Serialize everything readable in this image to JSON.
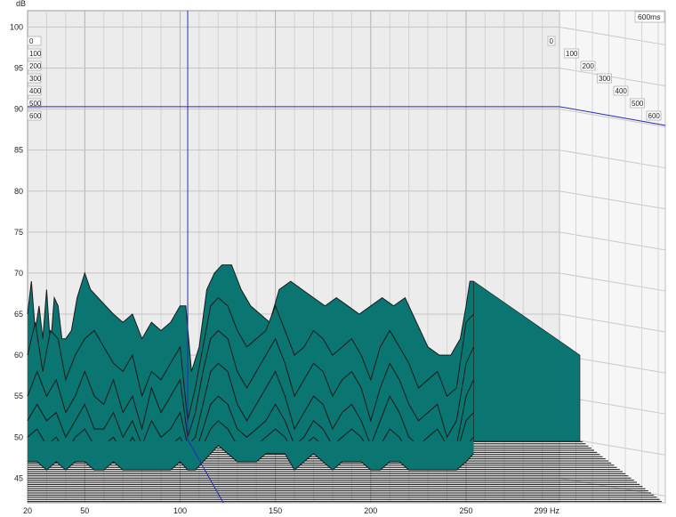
{
  "chart_data": {
    "type": "area",
    "title": "",
    "xlabel": "Hz",
    "ylabel": "dB",
    "x_ticks": [
      20,
      50,
      100,
      150,
      200,
      250,
      299
    ],
    "x_tick_labels": [
      "20",
      "50",
      "100",
      "150",
      "200",
      "250",
      "299 Hz"
    ],
    "y_ticks": [
      45,
      50,
      55,
      60,
      65,
      70,
      75,
      80,
      85,
      90,
      95,
      100
    ],
    "xlim": [
      20,
      299
    ],
    "ylim": [
      42,
      102
    ],
    "time_unit": "ms",
    "time_slices": [
      0,
      100,
      200,
      300,
      400,
      500,
      600
    ],
    "time_label_max": "600ms",
    "cursor": {
      "freq_hz": 104,
      "level_db": 90.3
    },
    "grid": true,
    "fill_color": "#0b7571",
    "curve_color": "#1a1a1a",
    "cursor_color": "#2a2ab4",
    "series": [
      {
        "name": "0",
        "x": [
          20,
          22,
          24,
          26,
          28,
          30,
          32,
          34,
          36,
          38,
          40,
          43,
          46,
          50,
          53,
          57,
          61,
          65,
          70,
          75,
          80,
          85,
          90,
          95,
          100,
          103,
          106,
          110,
          114,
          118,
          122,
          127,
          132,
          137,
          142,
          147,
          152,
          158,
          164,
          170,
          176,
          182,
          188,
          194,
          200,
          206,
          212,
          218,
          224,
          230,
          236,
          242,
          247,
          250,
          252,
          254
        ],
        "y": [
          65,
          69,
          63,
          66,
          62,
          68,
          61,
          67,
          66,
          62,
          62,
          63,
          67,
          70,
          68,
          67,
          66,
          65,
          64,
          65,
          62,
          64,
          63,
          64,
          66,
          66,
          58,
          61,
          68,
          70,
          71,
          71,
          68,
          66,
          65,
          64,
          68,
          69,
          68,
          67,
          66,
          67,
          66,
          65,
          66,
          67,
          66,
          67,
          64,
          61,
          60,
          60,
          62,
          66,
          69,
          69
        ]
      },
      {
        "name": "100",
        "x": [
          20,
          24,
          28,
          32,
          36,
          40,
          45,
          50,
          55,
          60,
          65,
          70,
          75,
          80,
          85,
          90,
          95,
          100,
          104,
          108,
          112,
          116,
          120,
          125,
          130,
          135,
          140,
          145,
          150,
          155,
          160,
          165,
          170,
          175,
          180,
          185,
          190,
          195,
          200,
          205,
          210,
          215,
          220,
          225,
          230,
          235,
          240,
          245,
          250,
          254
        ],
        "y": [
          60,
          64,
          58,
          63,
          62,
          57,
          60,
          62,
          63,
          61,
          59,
          58,
          60,
          55,
          58,
          57,
          59,
          61,
          52,
          56,
          61,
          66,
          67,
          66,
          63,
          61,
          62,
          63,
          66,
          63,
          60,
          61,
          63,
          62,
          60,
          61,
          62,
          60,
          57,
          61,
          63,
          61,
          59,
          56,
          57,
          58,
          55,
          56,
          64,
          65
        ]
      },
      {
        "name": "200",
        "x": [
          20,
          25,
          30,
          35,
          40,
          45,
          50,
          55,
          60,
          65,
          70,
          75,
          80,
          85,
          90,
          95,
          100,
          104,
          108,
          112,
          116,
          120,
          125,
          130,
          135,
          140,
          145,
          150,
          155,
          160,
          165,
          170,
          175,
          180,
          185,
          190,
          195,
          200,
          205,
          210,
          215,
          220,
          225,
          230,
          235,
          240,
          245,
          250,
          254
        ],
        "y": [
          55,
          58,
          55,
          57,
          53,
          55,
          58,
          55,
          54,
          57,
          53,
          55,
          51,
          56,
          53,
          55,
          57,
          50,
          53,
          58,
          62,
          63,
          62,
          58,
          56,
          58,
          60,
          62,
          59,
          55,
          57,
          59,
          58,
          55,
          57,
          58,
          56,
          52,
          56,
          59,
          57,
          54,
          52,
          53,
          54,
          50,
          52,
          59,
          61
        ]
      },
      {
        "name": "300",
        "x": [
          20,
          25,
          30,
          35,
          40,
          45,
          50,
          55,
          60,
          65,
          70,
          75,
          80,
          85,
          90,
          95,
          100,
          104,
          108,
          112,
          116,
          120,
          125,
          130,
          135,
          140,
          145,
          150,
          155,
          160,
          165,
          170,
          175,
          180,
          185,
          190,
          195,
          200,
          205,
          210,
          215,
          220,
          225,
          230,
          235,
          240,
          245,
          250,
          254
        ],
        "y": [
          52,
          54,
          52,
          53,
          50,
          52,
          54,
          51,
          51,
          53,
          50,
          52,
          49,
          52,
          50,
          51,
          53,
          49,
          50,
          54,
          58,
          59,
          58,
          54,
          52,
          54,
          56,
          58,
          55,
          51,
          53,
          55,
          54,
          51,
          53,
          54,
          52,
          49,
          52,
          55,
          53,
          50,
          49,
          50,
          51,
          49,
          49,
          55,
          57
        ]
      },
      {
        "name": "400",
        "x": [
          20,
          25,
          30,
          35,
          40,
          45,
          50,
          55,
          60,
          65,
          70,
          75,
          80,
          85,
          90,
          95,
          100,
          104,
          108,
          112,
          116,
          120,
          125,
          130,
          135,
          140,
          145,
          150,
          155,
          160,
          165,
          170,
          175,
          180,
          185,
          190,
          195,
          200,
          205,
          210,
          215,
          220,
          225,
          230,
          235,
          240,
          245,
          250,
          254
        ],
        "y": [
          50,
          51,
          49,
          50,
          48,
          50,
          51,
          49,
          49,
          50,
          48,
          50,
          48,
          49,
          48,
          49,
          50,
          48,
          48,
          51,
          54,
          55,
          54,
          51,
          50,
          51,
          52,
          54,
          52,
          49,
          50,
          52,
          51,
          49,
          50,
          51,
          50,
          48,
          49,
          51,
          50,
          48,
          48,
          48,
          49,
          48,
          48,
          52,
          53
        ]
      },
      {
        "name": "500",
        "x": [
          20,
          25,
          30,
          35,
          40,
          45,
          50,
          55,
          60,
          65,
          70,
          75,
          80,
          85,
          90,
          95,
          100,
          104,
          108,
          112,
          116,
          120,
          125,
          130,
          135,
          140,
          145,
          150,
          155,
          160,
          165,
          170,
          175,
          180,
          185,
          190,
          195,
          200,
          205,
          210,
          215,
          220,
          225,
          230,
          235,
          240,
          245,
          250,
          254
        ],
        "y": [
          48,
          49,
          48,
          48,
          47,
          48,
          49,
          48,
          48,
          48,
          47,
          48,
          47,
          48,
          47,
          48,
          48,
          47,
          47,
          49,
          51,
          52,
          51,
          49,
          48,
          49,
          50,
          51,
          50,
          48,
          49,
          50,
          49,
          48,
          48,
          49,
          48,
          47,
          48,
          49,
          48,
          47,
          47,
          47,
          48,
          47,
          47,
          49,
          50
        ]
      },
      {
        "name": "600",
        "x": [
          20,
          25,
          30,
          35,
          40,
          45,
          50,
          55,
          60,
          65,
          70,
          75,
          80,
          85,
          90,
          95,
          100,
          104,
          108,
          112,
          116,
          120,
          125,
          130,
          135,
          140,
          145,
          150,
          155,
          160,
          165,
          170,
          175,
          180,
          185,
          190,
          195,
          200,
          205,
          210,
          215,
          220,
          225,
          230,
          235,
          240,
          245,
          250,
          254
        ],
        "y": [
          47,
          47,
          46,
          47,
          46,
          47,
          47,
          46,
          46,
          47,
          46,
          46,
          46,
          46,
          46,
          46,
          47,
          46,
          46,
          47,
          48,
          49,
          48,
          47,
          47,
          47,
          48,
          48,
          48,
          46,
          47,
          48,
          47,
          46,
          47,
          47,
          47,
          46,
          46,
          47,
          47,
          46,
          46,
          46,
          46,
          46,
          46,
          47,
          48
        ]
      }
    ]
  }
}
